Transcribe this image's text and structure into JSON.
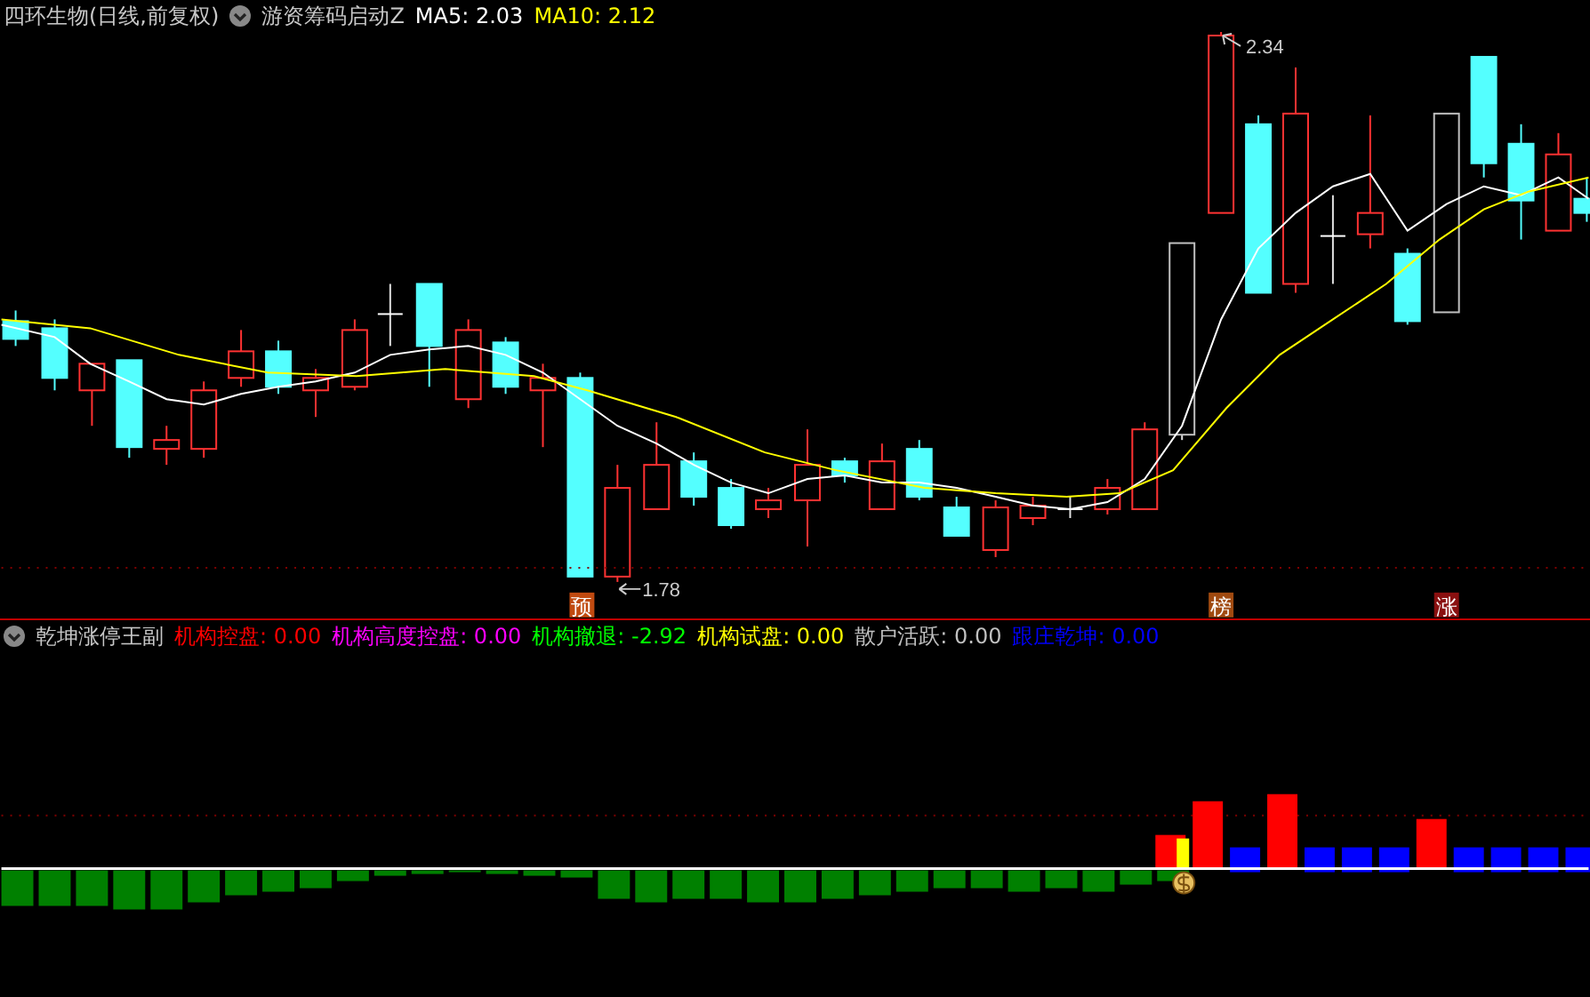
{
  "header": {
    "stock": "四环生物(日线,前复权)",
    "indicator": "游资筹码启动Z",
    "ma": [
      {
        "label": "MA5:",
        "value": "2.03",
        "color": "#ffffff"
      },
      {
        "label": "MA10:",
        "value": "2.12",
        "color": "#ffff00"
      }
    ]
  },
  "price_chart": {
    "high_label": "2.34",
    "low_label": "1.78",
    "signals": [
      {
        "text": "预",
        "color": "#c04a10"
      },
      {
        "text": "榜",
        "color": "#a04a10"
      },
      {
        "text": "涨",
        "color": "#8a1010"
      }
    ]
  },
  "indicator_panel": {
    "name": "乾坤涨停王副",
    "items": [
      {
        "label": "机构控盘:",
        "value": "0.00",
        "color": "#ff0000"
      },
      {
        "label": "机构高度控盘:",
        "value": "0.00",
        "color": "#ff00ff"
      },
      {
        "label": "机构撤退:",
        "value": "-2.92",
        "color": "#00ff00"
      },
      {
        "label": "机构试盘:",
        "value": "0.00",
        "color": "#ffff00"
      },
      {
        "label": "散户活跃:",
        "value": "0.00",
        "color": "#c0c0c0"
      },
      {
        "label": "跟庄乾坤:",
        "value": "0.00",
        "color": "#0000ff"
      }
    ]
  }
}
